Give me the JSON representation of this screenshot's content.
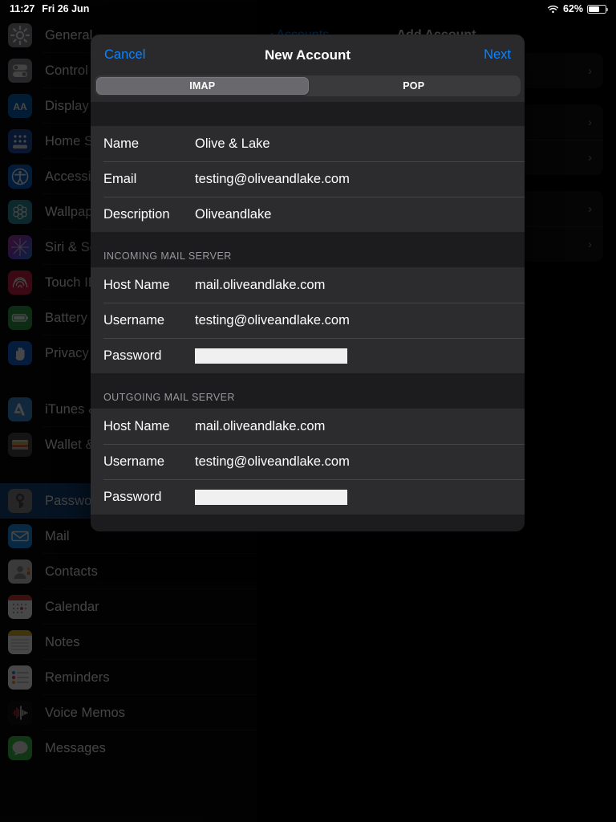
{
  "status_bar": {
    "time": "11:27",
    "date": "Fri 26 Jun",
    "battery_percent": "62%",
    "wifi_icon": "wifi-icon",
    "battery_icon": "battery-icon"
  },
  "sidebar": {
    "items": [
      {
        "label": "General",
        "icon": "gear-icon",
        "selected": false
      },
      {
        "label": "Control Center",
        "icon": "toggles-icon",
        "selected": false
      },
      {
        "label": "Display & Brightness",
        "icon": "display-aa-icon",
        "selected": false
      },
      {
        "label": "Home Screen & Dock",
        "icon": "home-grid-icon",
        "selected": false
      },
      {
        "label": "Accessibility",
        "icon": "accessibility-icon",
        "selected": false
      },
      {
        "label": "Wallpaper",
        "icon": "wallpaper-flower-icon",
        "selected": false
      },
      {
        "label": "Siri & Search",
        "icon": "siri-icon",
        "selected": false
      },
      {
        "label": "Touch ID & Passcode",
        "icon": "fingerprint-icon",
        "selected": false
      },
      {
        "label": "Battery",
        "icon": "battery-icon",
        "selected": false
      },
      {
        "label": "Privacy",
        "icon": "privacy-hand-icon",
        "selected": false
      }
    ],
    "items_group2": [
      {
        "label": "iTunes & App Store",
        "icon": "app-store-icon",
        "selected": false
      },
      {
        "label": "Wallet & Apple Pay",
        "icon": "wallet-icon",
        "selected": false
      }
    ],
    "items_group3": [
      {
        "label": "Passwords & Accounts",
        "icon": "key-icon",
        "selected": true
      },
      {
        "label": "Mail",
        "icon": "mail-envelope-icon",
        "selected": false
      },
      {
        "label": "Contacts",
        "icon": "contacts-person-icon",
        "selected": false
      },
      {
        "label": "Calendar",
        "icon": "calendar-icon",
        "selected": false
      },
      {
        "label": "Notes",
        "icon": "notes-icon",
        "selected": false
      },
      {
        "label": "Reminders",
        "icon": "reminders-icon",
        "selected": false
      },
      {
        "label": "Voice Memos",
        "icon": "voice-memos-icon",
        "selected": false
      },
      {
        "label": "Messages",
        "icon": "messages-bubble-icon",
        "selected": false
      }
    ]
  },
  "background_detail": {
    "back_label": "Accounts",
    "title": "Add Account",
    "rows": [
      {
        "label": "",
        "chevron": "chevron-right-icon"
      },
      {
        "label": "",
        "chevron": "chevron-right-icon"
      },
      {
        "label": "",
        "chevron": "chevron-right-icon"
      },
      {
        "label": "",
        "chevron": "chevron-right-icon"
      },
      {
        "label": "",
        "chevron": "chevron-right-icon"
      }
    ]
  },
  "modal": {
    "cancel_label": "Cancel",
    "title": "New Account",
    "next_label": "Next",
    "segments": [
      {
        "label": "IMAP",
        "active": true
      },
      {
        "label": "POP",
        "active": false
      }
    ],
    "account_section": {
      "rows": [
        {
          "label": "Name",
          "value": "Olive & Lake"
        },
        {
          "label": "Email",
          "value": "testing@oliveandlake.com"
        },
        {
          "label": "Description",
          "value": "Oliveandlake"
        }
      ]
    },
    "incoming_section": {
      "header": "INCOMING MAIL SERVER",
      "rows": [
        {
          "label": "Host Name",
          "value": "mail.oliveandlake.com",
          "redacted": false
        },
        {
          "label": "Username",
          "value": "testing@oliveandlake.com",
          "redacted": false
        },
        {
          "label": "Password",
          "value": "",
          "redacted": true
        }
      ]
    },
    "outgoing_section": {
      "header": "OUTGOING MAIL SERVER",
      "rows": [
        {
          "label": "Host Name",
          "value": "mail.oliveandlake.com",
          "redacted": false
        },
        {
          "label": "Username",
          "value": "testing@oliveandlake.com",
          "redacted": false
        },
        {
          "label": "Password",
          "value": "",
          "redacted": true
        }
      ]
    }
  },
  "colors": {
    "accent_blue": "#0a84ff",
    "selected_row": "#14467e",
    "modal_bg": "#1c1c1e",
    "row_bg": "#2c2c2e",
    "nav_bg": "#2a2a2c"
  }
}
